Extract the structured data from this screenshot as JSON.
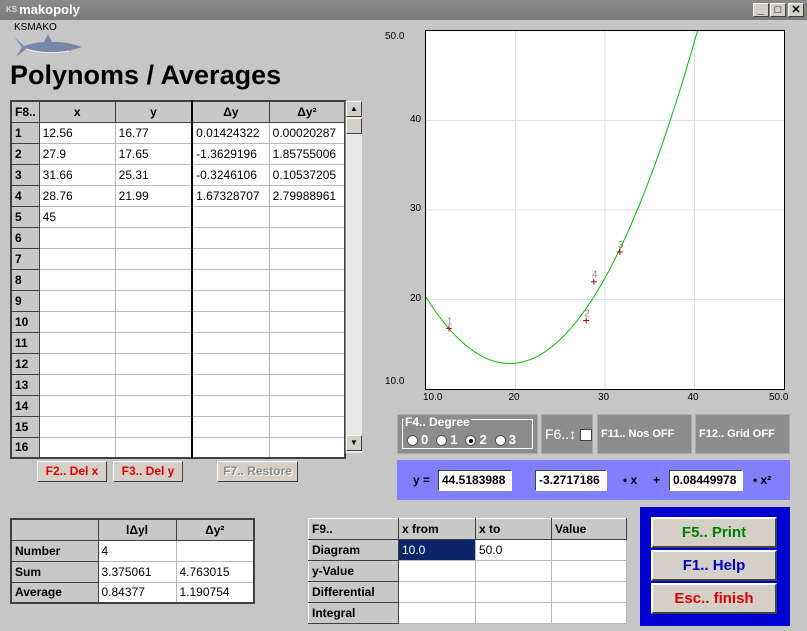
{
  "window": {
    "title": "makopoly",
    "icon_text": "KS",
    "buttons": [
      "minimize",
      "maximize",
      "close"
    ]
  },
  "logo": {
    "text": "KSMAKO",
    "image": "shark"
  },
  "page_title": "Polynoms / Averages",
  "grid": {
    "corner": "F8..",
    "headers": [
      "x",
      "y",
      "Δy",
      "Δy²"
    ],
    "rows": [
      {
        "n": "1",
        "x": "12.56",
        "y": "16.77",
        "dy": "0.01424322",
        "dy2": "0.00020287"
      },
      {
        "n": "2",
        "x": "27.9",
        "y": "17.65",
        "dy": "-1.3629196",
        "dy2": "1.85755006"
      },
      {
        "n": "3",
        "x": "31.66",
        "y": "25.31",
        "dy": "-0.3246106",
        "dy2": "0.10537205"
      },
      {
        "n": "4",
        "x": "28.76",
        "y": "21.99",
        "dy": "1.67328707",
        "dy2": "2.79988961"
      },
      {
        "n": "5",
        "x": "45",
        "y": "",
        "dy": "",
        "dy2": ""
      },
      {
        "n": "6"
      },
      {
        "n": "7"
      },
      {
        "n": "8"
      },
      {
        "n": "9"
      },
      {
        "n": "10"
      },
      {
        "n": "11"
      },
      {
        "n": "12"
      },
      {
        "n": "13"
      },
      {
        "n": "14"
      },
      {
        "n": "15"
      },
      {
        "n": "16"
      }
    ]
  },
  "buttons": {
    "del_x": "F2.. Del x",
    "del_y": "F3.. Del y",
    "restore": "F7.. Restore",
    "print": "F5.. Print",
    "help": "F1.. Help",
    "finish": "Esc.. finish"
  },
  "stats": {
    "headers": [
      "lΔyl",
      "Δy²"
    ],
    "rows": [
      {
        "label": "Number",
        "a": "4",
        "b": ""
      },
      {
        "label": "Sum",
        "a": "3.375061",
        "b": "4.763015"
      },
      {
        "label": "Average",
        "a": "0.84377",
        "b": "1.190754"
      }
    ]
  },
  "f9": {
    "headers": [
      "F9..",
      "x  from",
      "x  to",
      "Value"
    ],
    "rows": [
      {
        "label": "Diagram",
        "from": "10.0",
        "to": "50.0",
        "value": ""
      },
      {
        "label": "y-Value",
        "from": "",
        "to": "",
        "value": ""
      },
      {
        "label": "Differential",
        "from": "",
        "to": "",
        "value": ""
      },
      {
        "label": "Integral",
        "from": "",
        "to": "",
        "value": ""
      }
    ]
  },
  "controls": {
    "degree_label": "F4.. Degree",
    "degrees": [
      "0",
      "1",
      "2",
      "3"
    ],
    "degree_selected": "2",
    "f6": "F6..↕",
    "f11": "F11.. Nos OFF",
    "f12": "F12.. Grid OFF"
  },
  "equation": {
    "y_label": "y =",
    "c0": "44.5183988",
    "c1": "-3.2717186",
    "x_label": "• x",
    "plus": "+",
    "c2": "0.08449978",
    "x2_label": "• x²"
  },
  "chart_data": {
    "type": "scatter",
    "xlim": [
      10,
      50
    ],
    "ylim": [
      10,
      50
    ],
    "x_ticks": [
      "10.0",
      "20",
      "30",
      "40",
      "50.0"
    ],
    "y_ticks": [
      "10.0",
      "20",
      "30",
      "40",
      "50.0"
    ],
    "grid": true,
    "points": [
      {
        "label": "1",
        "x": 12.56,
        "y": 16.77
      },
      {
        "label": "2",
        "x": 27.9,
        "y": 17.65
      },
      {
        "label": "3",
        "x": 31.66,
        "y": 25.31
      },
      {
        "label": "4",
        "x": 28.76,
        "y": 21.99
      }
    ],
    "curve": {
      "coefficients": [
        44.5183988,
        -3.2717186,
        0.08449978
      ],
      "color": "#00c000"
    },
    "point_color": "#c00000"
  }
}
